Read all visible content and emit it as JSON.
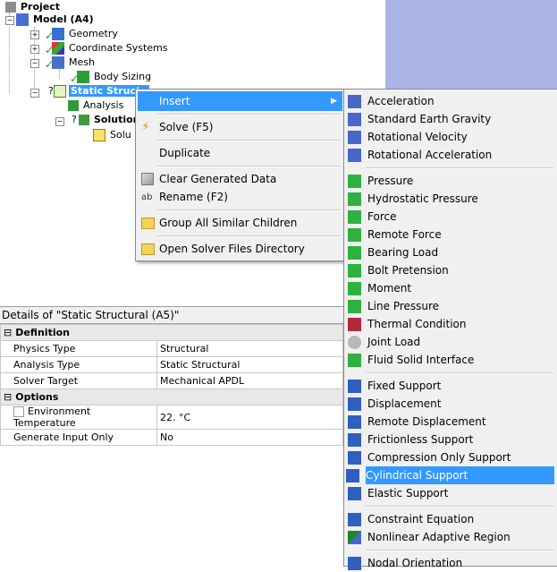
{
  "tree": {
    "project": "Project",
    "model": "Model (A4)",
    "geometry": "Geometry",
    "coordinate_systems": "Coordinate Systems",
    "mesh": "Mesh",
    "body_sizing": "Body Sizing",
    "static_structural": "Static Structu",
    "analysis": "Analysis",
    "solution": "Solution",
    "solution_info": "Solu"
  },
  "details": {
    "title": "Details of \"Static Structural (A5)\"",
    "groups": [
      {
        "name": "Definition",
        "rows": [
          {
            "label": "Physics Type",
            "value": "Structural"
          },
          {
            "label": "Analysis Type",
            "value": "Static Structural"
          },
          {
            "label": "Solver Target",
            "value": "Mechanical APDL"
          }
        ]
      },
      {
        "name": "Options",
        "rows": [
          {
            "label": "Environment Temperature",
            "value": "22. °C"
          },
          {
            "label": "Generate Input Only",
            "value": "No"
          }
        ]
      }
    ]
  },
  "context_menu": {
    "items": [
      "Insert",
      "Solve (F5)",
      "Duplicate",
      "Clear Generated Data",
      "Rename (F2)",
      "Group All Similar Children",
      "Open Solver Files Directory"
    ],
    "submenu_arrow": "▶"
  },
  "insert_submenu": {
    "items": [
      "Acceleration",
      "Standard Earth Gravity",
      "Rotational Velocity",
      "Rotational Acceleration",
      "Pressure",
      "Hydrostatic Pressure",
      "Force",
      "Remote Force",
      "Bearing Load",
      "Bolt Pretension",
      "Moment",
      "Line Pressure",
      "Thermal Condition",
      "Joint Load",
      "Fluid Solid Interface",
      "Fixed Support",
      "Displacement",
      "Remote Displacement",
      "Frictionless Support",
      "Compression Only Support",
      "Cylindrical Support",
      "Elastic Support",
      "Constraint Equation",
      "Nonlinear Adaptive Region",
      "Nodal Orientation"
    ],
    "highlighted": "Cylindrical Support"
  },
  "colors": {
    "selection": "#3399ff",
    "menu_bg": "#f0f0f0",
    "graphics_bg": "#aab4e6"
  }
}
